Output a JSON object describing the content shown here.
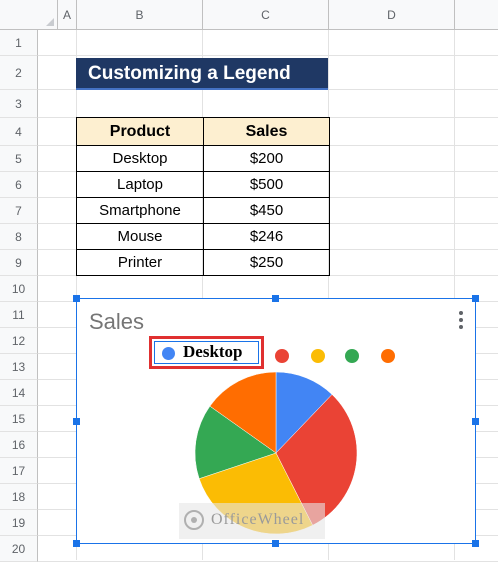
{
  "columns": [
    "A",
    "B",
    "C",
    "D"
  ],
  "rows": [
    "1",
    "2",
    "3",
    "4",
    "5",
    "6",
    "7",
    "8",
    "9",
    "10",
    "11",
    "12",
    "13",
    "14",
    "15",
    "16",
    "17",
    "18",
    "19",
    "20"
  ],
  "title": "Customizing a Legend",
  "table": {
    "headers": [
      "Product",
      "Sales"
    ],
    "rows": [
      [
        "Desktop",
        "$200"
      ],
      [
        "Laptop",
        "$500"
      ],
      [
        "Smartphone",
        "$450"
      ],
      [
        "Mouse",
        "$246"
      ],
      [
        "Printer",
        "$250"
      ]
    ]
  },
  "chart": {
    "title": "Sales",
    "legend_label": "Desktop",
    "watermark": "OfficeWheel"
  },
  "chart_data": {
    "type": "pie",
    "title": "Sales",
    "legend_position": "top",
    "categories": [
      "Desktop",
      "Laptop",
      "Smartphone",
      "Mouse",
      "Printer"
    ],
    "values": [
      200,
      500,
      450,
      246,
      250
    ],
    "colors": [
      "#4285f4",
      "#ea4335",
      "#fbbc04",
      "#34a853",
      "#ff6d01"
    ]
  }
}
